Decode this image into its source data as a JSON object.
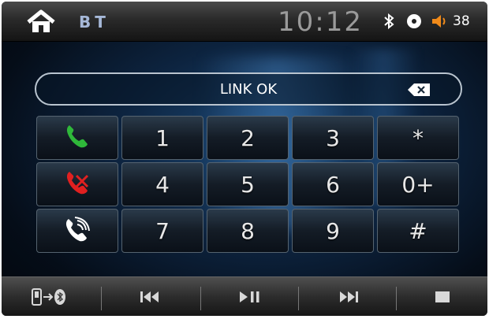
{
  "status_bar": {
    "source_label": "BT",
    "time": "10:12",
    "volume": "38",
    "icons": [
      "home-icon",
      "bluetooth-icon",
      "disc-icon",
      "volume-icon"
    ]
  },
  "display": {
    "text": "LINK OK",
    "backspace_icon": "backspace-icon"
  },
  "keypad": {
    "rows": [
      [
        {
          "type": "icon",
          "name": "call-answer-icon",
          "color": "#2fb83a"
        },
        {
          "type": "text",
          "label": "1"
        },
        {
          "type": "text",
          "label": "2"
        },
        {
          "type": "text",
          "label": "3"
        },
        {
          "type": "text",
          "label": "*"
        }
      ],
      [
        {
          "type": "icon",
          "name": "call-end-icon",
          "color": "#e02020"
        },
        {
          "type": "text",
          "label": "4"
        },
        {
          "type": "text",
          "label": "5"
        },
        {
          "type": "text",
          "label": "6"
        },
        {
          "type": "text",
          "label": "0+"
        }
      ],
      [
        {
          "type": "icon",
          "name": "call-transfer-icon",
          "color": "#ffffff"
        },
        {
          "type": "text",
          "label": "7"
        },
        {
          "type": "text",
          "label": "8"
        },
        {
          "type": "text",
          "label": "9"
        },
        {
          "type": "text",
          "label": "#"
        }
      ]
    ]
  },
  "bottom_bar": {
    "buttons": [
      "phone-to-bluetooth-icon",
      "previous-track-icon",
      "play-pause-icon",
      "next-track-icon",
      "stop-icon"
    ]
  }
}
